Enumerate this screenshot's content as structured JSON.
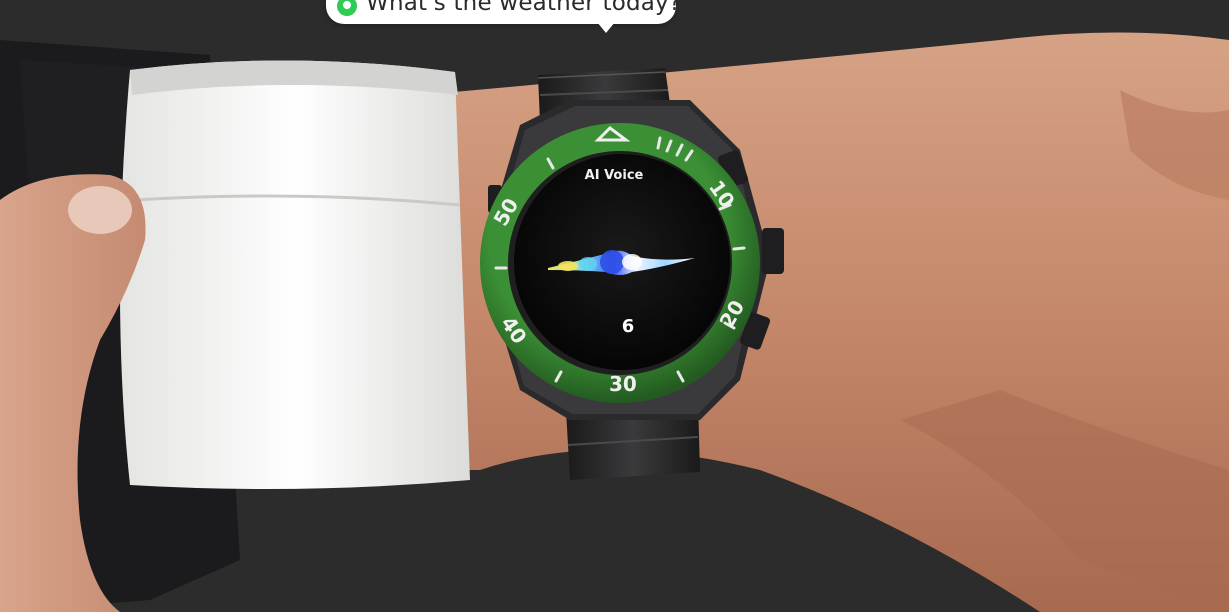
{
  "bubble": {
    "icon": "voice-assistant-icon",
    "text": "What's the weather today?"
  },
  "watch": {
    "screen_title": "AI Voice",
    "screen_value": "6",
    "bezel_numbers": [
      "10",
      "20",
      "30",
      "40",
      "50"
    ],
    "bezel_color": "#2f7a2c",
    "screen_color": "#0c0c0c"
  },
  "colors": {
    "background": "#2c2c2c",
    "skin": "#c98e6e",
    "shirt": "#f1f1ef",
    "jacket": "#1b1b1d"
  }
}
